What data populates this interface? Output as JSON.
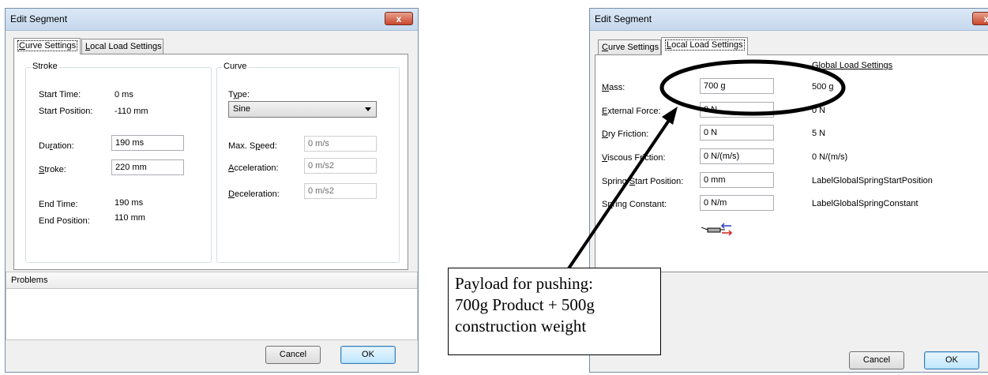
{
  "left_dialog": {
    "title": "Edit Segment",
    "close_symbol": "x",
    "tabs": [
      {
        "label": "Curve Settings",
        "mnemonic": "C",
        "rest": "urve Settings",
        "active": true
      },
      {
        "label": "Local Load Settings",
        "mnemonic": "L",
        "rest": "ocal Load Settings",
        "active": false
      }
    ],
    "stroke_group": {
      "title": "Stroke",
      "start_time_label": "Start Time:",
      "start_time_value": "0 ms",
      "start_position_label": "Start Position:",
      "start_position_value": "-110 mm",
      "duration_label_pre": "Du",
      "duration_label_mn": "r",
      "duration_label_post": "ation:",
      "duration_value": "190 ms",
      "stroke_label_mn": "S",
      "stroke_label_post": "troke:",
      "stroke_value": "220 mm",
      "end_time_label": "End Time:",
      "end_time_value": "190 ms",
      "end_position_label": "End Position:",
      "end_position_value": "110 mm"
    },
    "curve_group": {
      "title": "Curve",
      "type_label_pre": "T",
      "type_label_mn": "y",
      "type_label_post": "pe:",
      "type_value": "Sine",
      "max_speed_label_pre": "Max. S",
      "max_speed_label_mn": "p",
      "max_speed_label_post": "eed:",
      "max_speed_value": "0 m/s",
      "acceleration_label_mn": "A",
      "acceleration_label_post": "cceleration:",
      "acceleration_value": "0 m/s2",
      "deceleration_label_mn": "D",
      "deceleration_label_post": "eceleration:",
      "deceleration_value": "0 m/s2"
    },
    "problems_label": "Problems",
    "cancel_label": "Cancel",
    "ok_label": "OK"
  },
  "right_dialog": {
    "title": "Edit Segment",
    "tabs": [
      {
        "label": "Curve Settings",
        "mnemonic": "C",
        "rest": "urve Settings",
        "active": false
      },
      {
        "label": "Local Load Settings",
        "mnemonic": "L",
        "rest": "ocal Load Settings",
        "active": true
      }
    ],
    "global_header": "Global Load Settings",
    "rows": [
      {
        "label_mn": "M",
        "label_post": "ass:",
        "value": "700 g",
        "global": "500 g"
      },
      {
        "label_mn": "E",
        "label_post": "xternal Force:",
        "value": "0 N",
        "global": "0 N"
      },
      {
        "label_mn": "D",
        "label_post": "ry Friction:",
        "value": "0 N",
        "global": "5 N"
      },
      {
        "label_mn": "V",
        "label_post": "iscous Friction:",
        "value": "0 N/(m/s)",
        "global": "0 N/(m/s)"
      },
      {
        "label_pre": "Spring ",
        "label_mn": "S",
        "label_post": "tart Position:",
        "value": "0 mm",
        "global": "LabelGlobalSpringStartPosition"
      },
      {
        "label_pre": "S",
        "label_mn": "p",
        "label_post": "ring Constant:",
        "value": "0 N/m",
        "global": "LabelGlobalSpringConstant"
      }
    ],
    "cancel_label": "Cancel",
    "ok_label": "OK"
  },
  "annotation": {
    "lines": [
      "Payload for pushing:",
      "700g Product + 500g",
      "construction weight"
    ]
  },
  "colors": {
    "titlebar": "#c6d8ee",
    "close_button": "#c9482d",
    "annotation_stroke": "#000000"
  }
}
